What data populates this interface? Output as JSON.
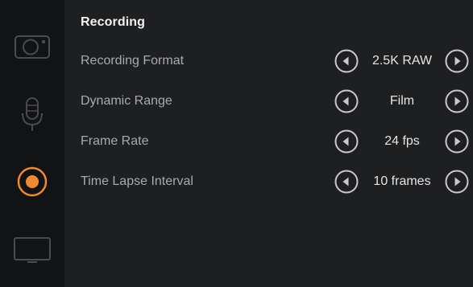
{
  "section": {
    "title": "Recording"
  },
  "sidebar": {
    "items": [
      {
        "icon": "camera-icon",
        "active": false
      },
      {
        "icon": "microphone-icon",
        "active": false
      },
      {
        "icon": "record-icon",
        "active": true
      },
      {
        "icon": "monitor-icon",
        "active": false
      }
    ]
  },
  "settings": [
    {
      "label": "Recording Format",
      "value": "2.5K RAW"
    },
    {
      "label": "Dynamic Range",
      "value": "Film"
    },
    {
      "label": "Frame Rate",
      "value": "24 fps"
    },
    {
      "label": "Time Lapse Interval",
      "value": "10 frames"
    }
  ],
  "colors": {
    "accent": "#f08a2c",
    "sidebar_bg": "#121314",
    "panel_bg": "#1e1f21",
    "inactive_icon": "#4a4b4e",
    "label_text": "#a9aaac",
    "value_text": "#e4e4e4"
  }
}
